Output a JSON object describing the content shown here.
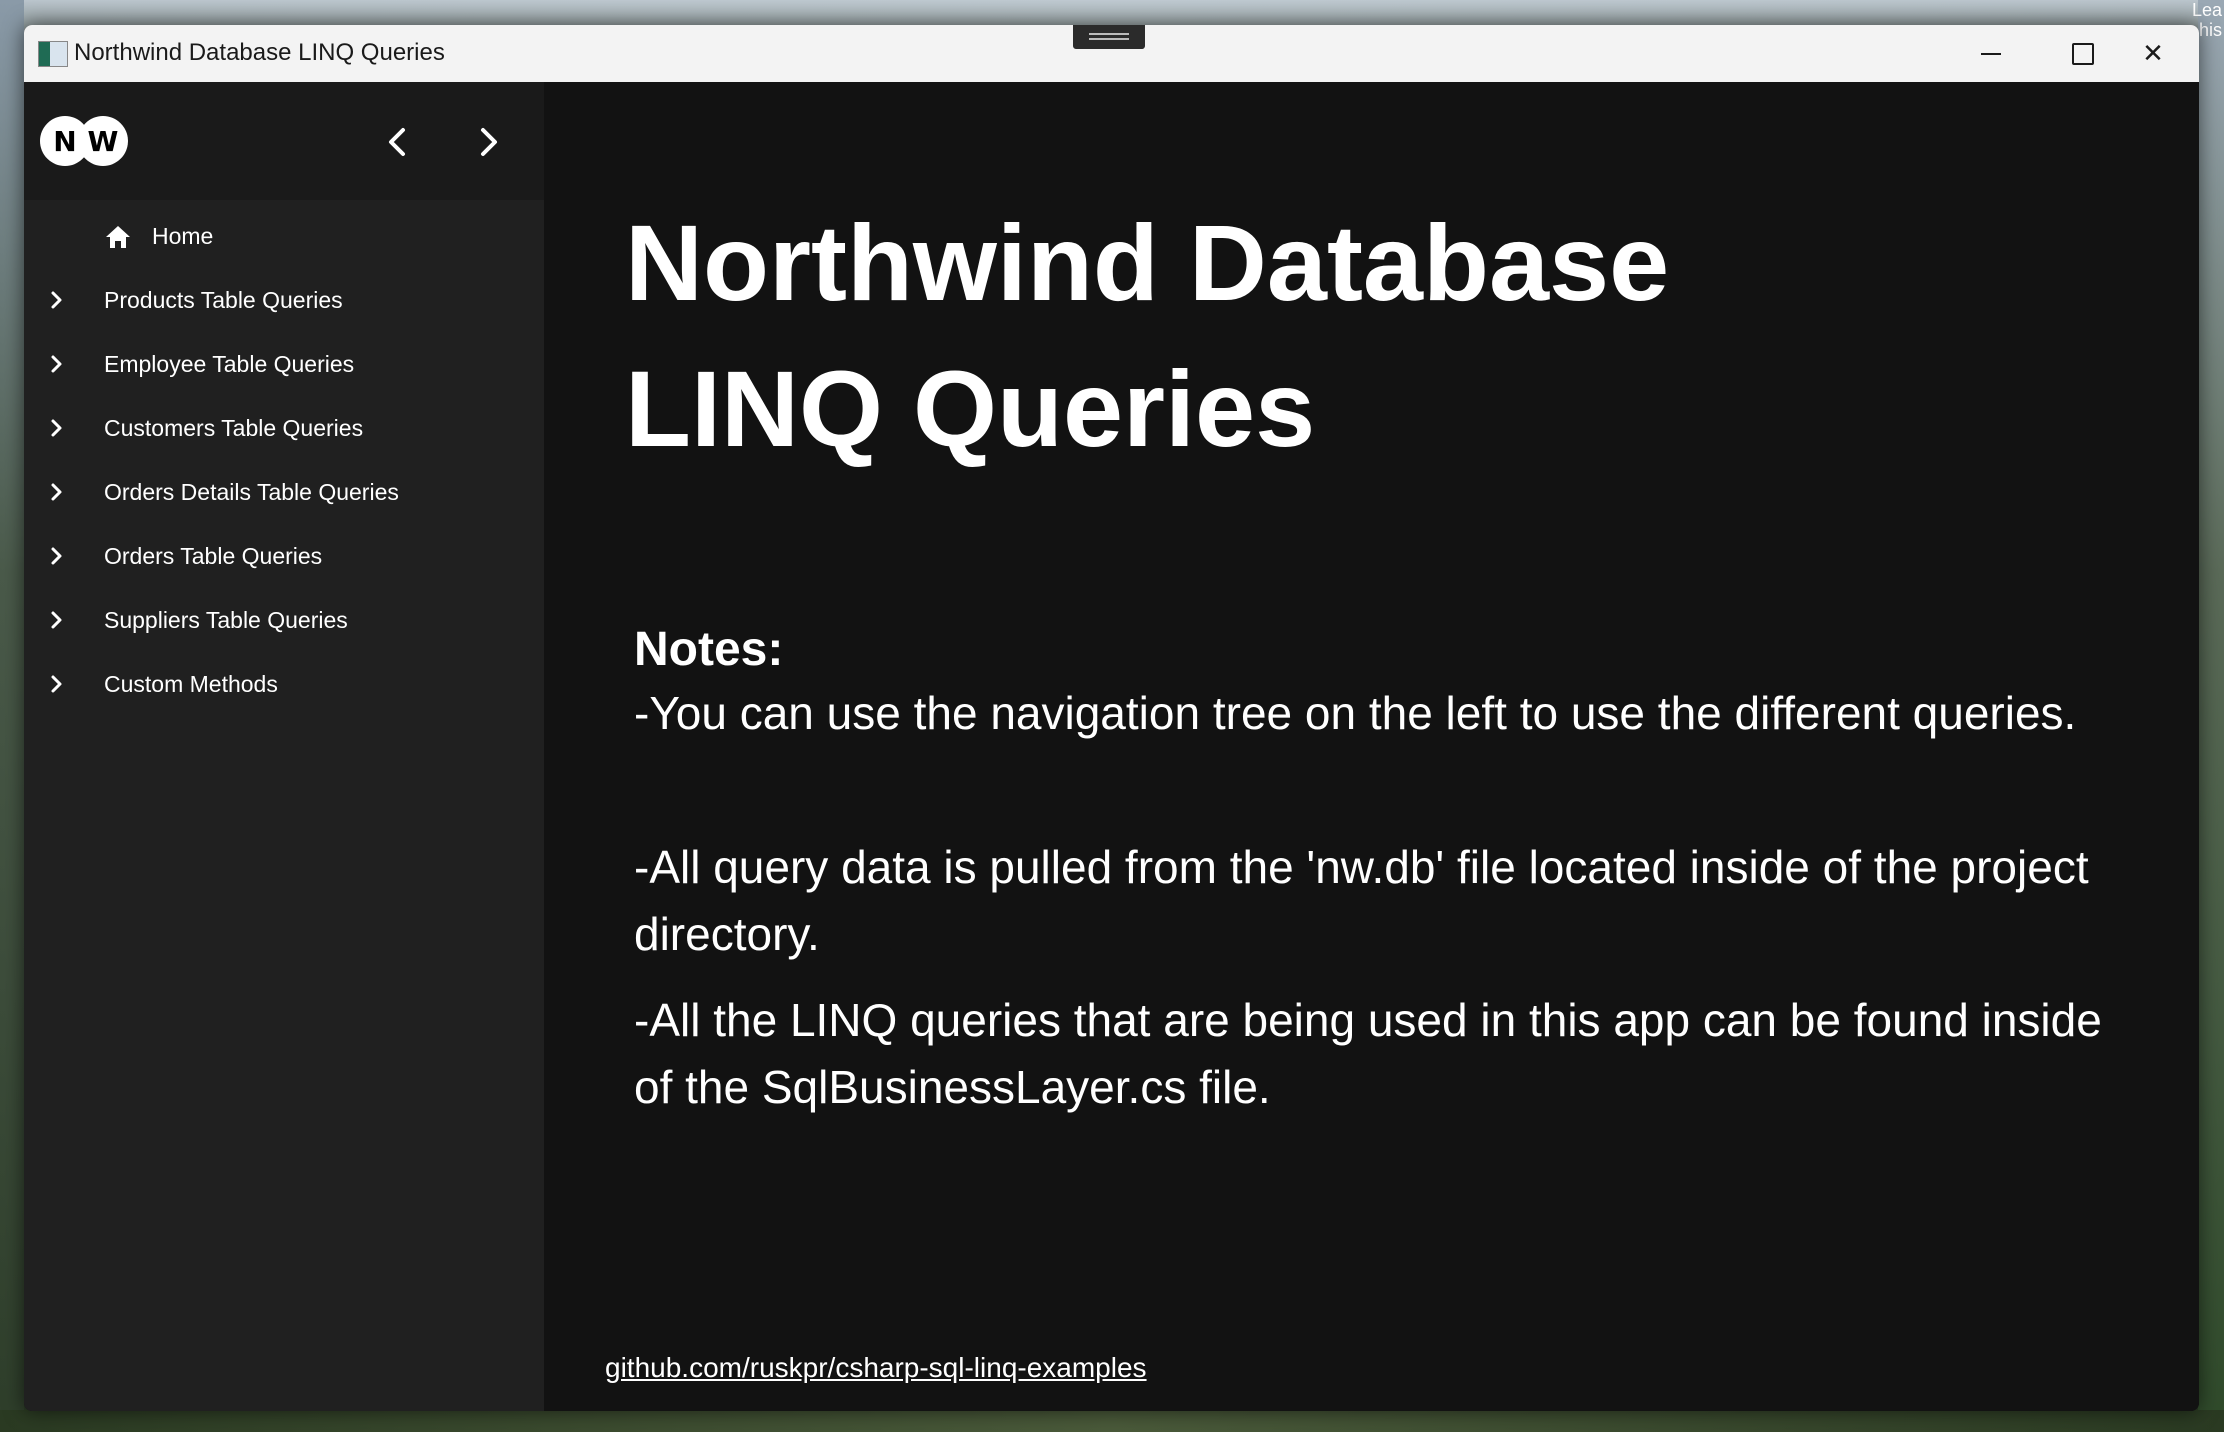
{
  "desktop": {
    "corner_text": [
      "Lea",
      "his"
    ]
  },
  "window": {
    "title": "Northwind Database LINQ Queries",
    "controls": {
      "minimize": "minimize",
      "maximize": "maximize",
      "close": "✕"
    }
  },
  "sidebar": {
    "logo": {
      "left": "N",
      "right": "W"
    },
    "back_glyph": "‹",
    "forward_glyph": "›",
    "items": [
      {
        "label": "Home",
        "icon": "home-icon"
      },
      {
        "label": "Products Table Queries",
        "icon": "chevron-right-icon"
      },
      {
        "label": "Employee Table Queries",
        "icon": "chevron-right-icon"
      },
      {
        "label": "Customers Table Queries",
        "icon": "chevron-right-icon"
      },
      {
        "label": "Orders Details Table Queries",
        "icon": "chevron-right-icon"
      },
      {
        "label": "Orders Table Queries",
        "icon": "chevron-right-icon"
      },
      {
        "label": "Suppliers Table Queries",
        "icon": "chevron-right-icon"
      },
      {
        "label": "Custom Methods",
        "icon": "chevron-right-icon"
      }
    ]
  },
  "main": {
    "title_line1": "Northwind Database",
    "title_line2": "LINQ Queries",
    "notes_heading": "Notes:",
    "notes": [
      "-You can use the navigation tree on the left to use the different queries.",
      "-All query data is pulled from the 'nw.db' file located inside of the project directory.",
      "-All the LINQ queries that are being used in this app can be found inside of the SqlBusinessLayer.cs file."
    ],
    "link": "github.com/ruskpr/csharp-sql-linq-examples"
  },
  "colors": {
    "titlebar": "#f3f3f3",
    "sidebar": "#202020",
    "content": "#121212",
    "text": "#ffffff"
  }
}
